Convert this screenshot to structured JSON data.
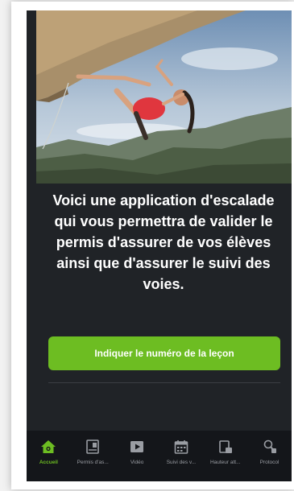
{
  "intro_text": "Voici une application d'escalade qui vous permettra de valider le permis d'assurer de vos élèves ainsi que d'assurer le suivi des voies.",
  "cta_label": "Indiquer le numéro de la leçon",
  "tabs": [
    {
      "label": "Accueil",
      "icon": "home-icon",
      "active": true
    },
    {
      "label": "Permis d'as...",
      "icon": "license-icon",
      "active": false
    },
    {
      "label": "Vidéo",
      "icon": "video-icon",
      "active": false
    },
    {
      "label": "Suivi des v...",
      "icon": "calendar-icon",
      "active": false
    },
    {
      "label": "Hauteur att...",
      "icon": "height-icon",
      "active": false
    },
    {
      "label": "Protocol",
      "icon": "protocol-icon",
      "active": false
    }
  ],
  "colors": {
    "accent": "#6dbd22",
    "background": "#202327",
    "tabbar": "#14161a"
  }
}
